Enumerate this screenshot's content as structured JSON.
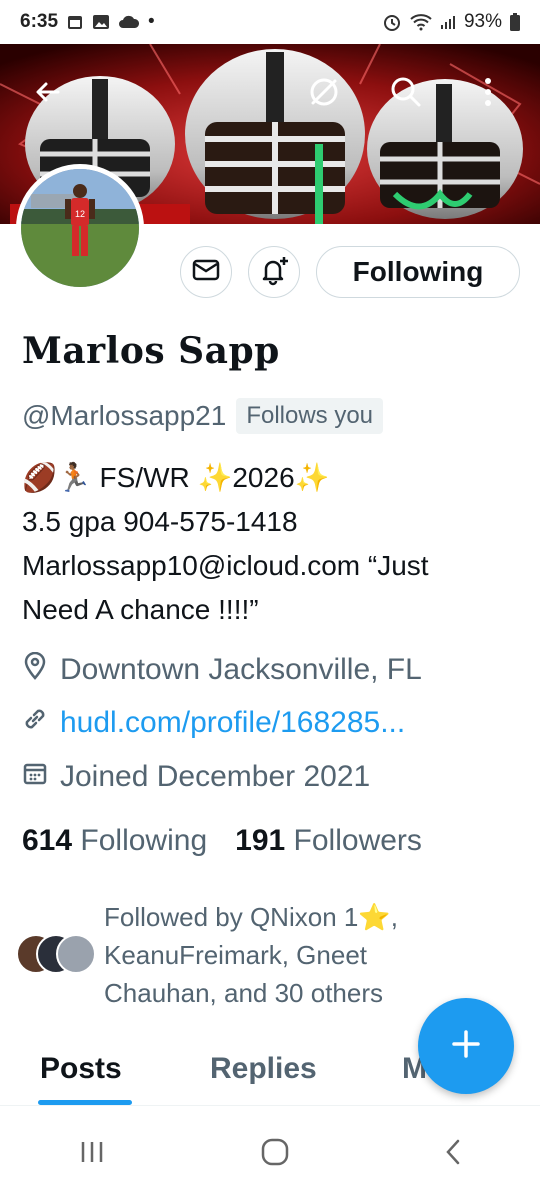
{
  "status_bar": {
    "time": "6:35",
    "battery": "93%",
    "dot": "•"
  },
  "banner": {
    "accent_color": "#d32626",
    "back_icon": "arrow-left-icon",
    "mute_icon": "eye-off-icon",
    "search_icon": "search-icon",
    "more_icon": "more-vertical-icon"
  },
  "avatar": {
    "jersey_number": "12"
  },
  "actions": {
    "message_icon": "envelope-icon",
    "notify_icon": "bell-plus-icon",
    "following_label": "Following"
  },
  "profile": {
    "display_name": "Marlos Sapp",
    "handle": "@Marlossapp21",
    "follows_you": "Follows you",
    "bio_lines": [
      "🏈🏃🏾 FS/WR ✨2026✨",
      "3.5 gpa 904-575-1418",
      "Marlossapp10@icloud.com “Just",
      "Need A chance !!!!”"
    ],
    "location": "Downtown Jacksonville, FL",
    "website": "hudl.com/profile/168285...",
    "joined": "Joined December 2021"
  },
  "counts": {
    "following_num": "614",
    "following_label": "Following",
    "followers_num": "191",
    "followers_label": "Followers"
  },
  "followed_by": {
    "lines": [
      "Followed by QNixon 1⭐,",
      "KeanuFreimark, Gneet",
      "Chauhan, and 30 others"
    ]
  },
  "tabs": {
    "items": [
      "Posts",
      "Replies",
      "M"
    ],
    "active": "Posts"
  },
  "fab": {
    "icon": "plus-icon"
  },
  "nav": {
    "recents_icon": "recents-icon",
    "home_icon": "home-icon",
    "back_icon": "back-chevron-icon"
  }
}
